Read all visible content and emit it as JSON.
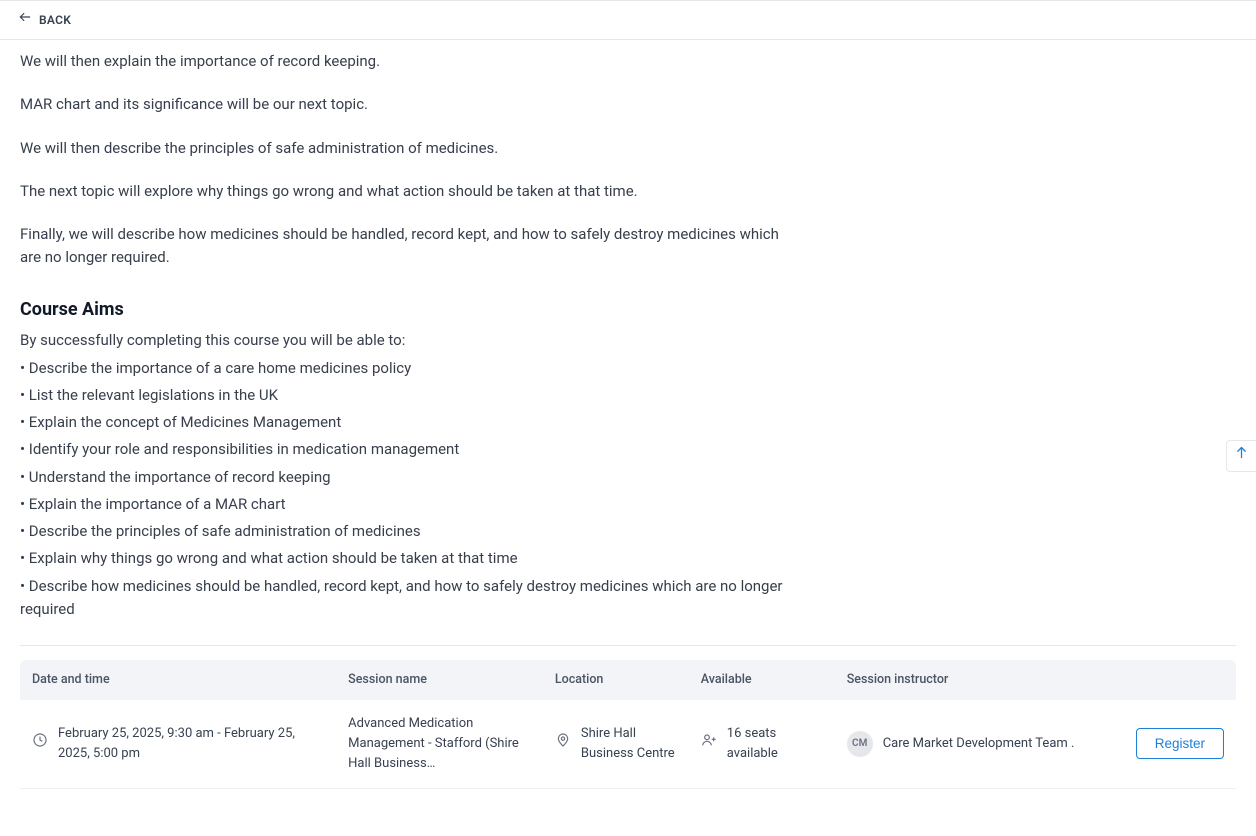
{
  "back": {
    "label": "BACK"
  },
  "body": {
    "p1": "We will then explain the importance of record keeping.",
    "p2": "MAR chart and its significance will be our next topic.",
    "p3": "We will then describe the principles of safe administration of medicines.",
    "p4": "The next topic will explore why things go wrong and what action should be taken at that time.",
    "p5": "Finally, we will describe how medicines should be handled, record kept, and how to safely destroy medicines which are no longer required."
  },
  "aims": {
    "heading": "Course Aims",
    "intro": "By successfully completing this course you will be able to:",
    "b1": "• Describe the importance of a care home medicines policy",
    "b2": "• List the relevant legislations in the UK",
    "b3": "• Explain the concept of Medicines Management",
    "b4": "• Identify your role and responsibilities in medication management",
    "b5": "• Understand the importance of record keeping",
    "b6": "• Explain the importance of a MAR chart",
    "b7": "• Describe the principles of safe administration of medicines",
    "b8": "• Explain why things go wrong and what action should be taken at that time",
    "b9": "• Describe how medicines should be handled, record kept, and how to safely destroy medicines which are no longer required"
  },
  "table": {
    "headers": {
      "datetime": "Date and time",
      "session": "Session name",
      "location": "Location",
      "available": "Available",
      "instructor": "Session instructor"
    },
    "row": {
      "datetime": "February 25, 2025, 9:30 am - February 25, 2025, 5:00 pm",
      "session": "Advanced Medication Management - Stafford (Shire Hall Business…",
      "location": "Shire Hall Business Centre",
      "available": "16 seats available",
      "instructor_initials": "CM",
      "instructor_name": "Care Market Development Team .",
      "register_label": "Register"
    }
  }
}
